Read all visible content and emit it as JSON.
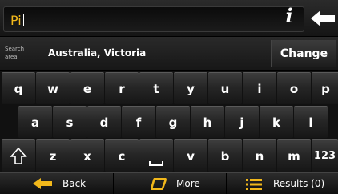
{
  "input": {
    "value": "Pi"
  },
  "icons": {
    "info": "info-icon",
    "backspace": "backspace-arrow-icon",
    "shift": "shift-arrow-icon",
    "space": "space-bar-icon",
    "back": "back-arrow-icon",
    "more": "more-shape-icon",
    "results": "list-icon"
  },
  "info_glyph": "i",
  "search_area": {
    "label": "Search area",
    "value": "Australia, Victoria",
    "change_label": "Change"
  },
  "keyboard": {
    "row1": [
      "q",
      "w",
      "e",
      "r",
      "t",
      "y",
      "u",
      "i",
      "o",
      "p"
    ],
    "row2": [
      "a",
      "s",
      "d",
      "f",
      "g",
      "h",
      "j",
      "k",
      "l"
    ],
    "row3": [
      "z",
      "x",
      "c",
      "v",
      "b",
      "n",
      "m"
    ],
    "numbers_key": "123"
  },
  "bottom_bar": {
    "back_label": "Back",
    "more_label": "More",
    "results_label": "Results (0)"
  },
  "colors": {
    "input_text": "#f2b81b",
    "back_arrow": "#f2b81b",
    "more_icon": "#f2b81b",
    "results_icon": "#f2b81b"
  }
}
